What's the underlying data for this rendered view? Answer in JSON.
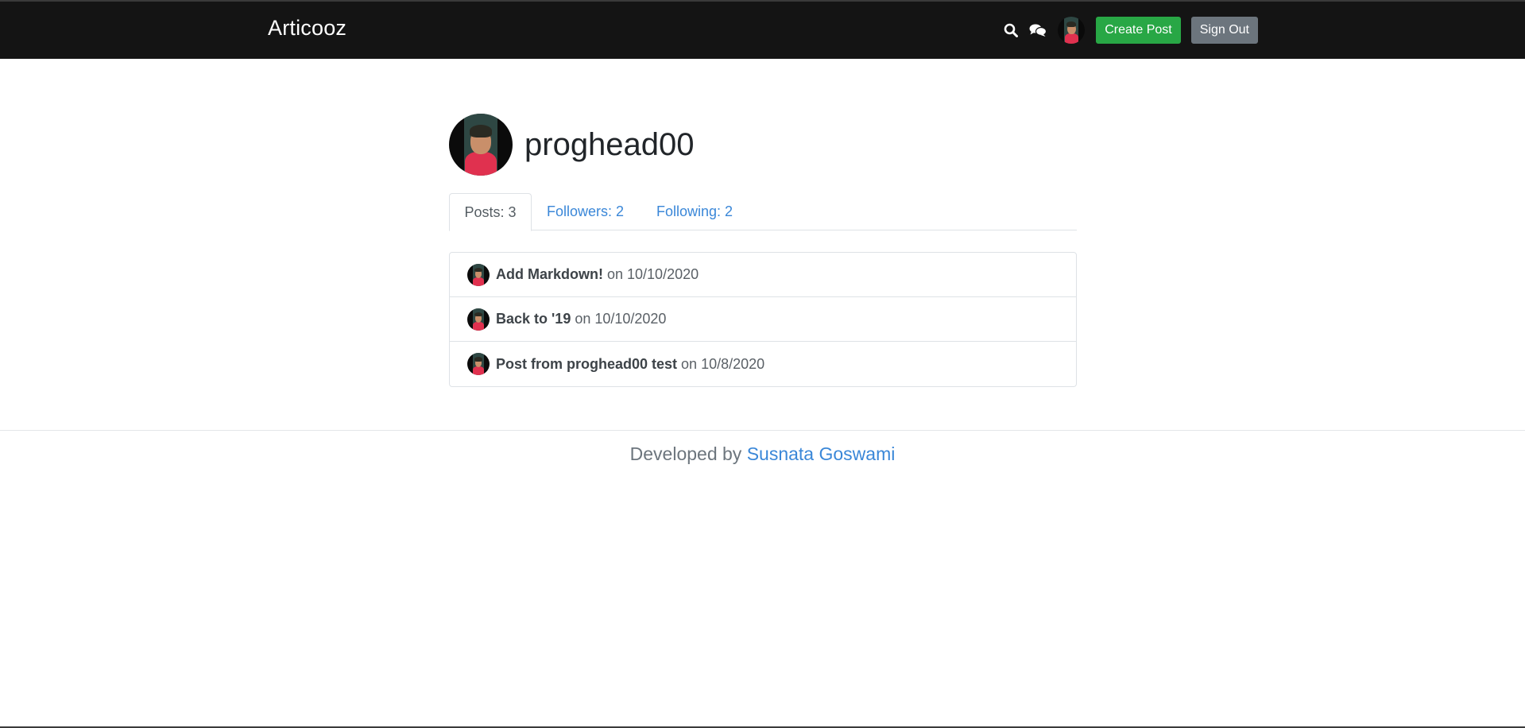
{
  "navbar": {
    "brand": "Articooz",
    "icons": [
      "search-icon",
      "chat-icon"
    ],
    "create_post_label": "Create Post",
    "sign_out_label": "Sign Out"
  },
  "profile": {
    "username": "proghead00"
  },
  "tabs": [
    {
      "label": "Posts: 3",
      "active": true
    },
    {
      "label": "Followers: 2",
      "active": false
    },
    {
      "label": "Following: 2",
      "active": false
    }
  ],
  "posts": [
    {
      "title": "Add Markdown!",
      "date_text": "on 10/10/2020"
    },
    {
      "title": "Back to '19",
      "date_text": "on 10/10/2020"
    },
    {
      "title": "Post from proghead00 test",
      "date_text": "on 10/8/2020"
    }
  ],
  "footer": {
    "prefix": "Developed by",
    "author": "Susnata Goswami"
  },
  "colors": {
    "navbar_bg": "#141414",
    "create_button": "#28a745",
    "sign_out_button": "#6c757d",
    "link": "#3a87d8"
  }
}
